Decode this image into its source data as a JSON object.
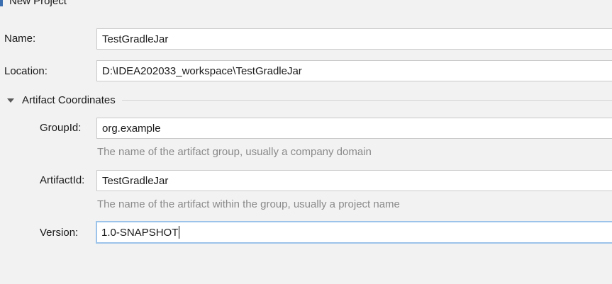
{
  "dialog": {
    "title": "New Project"
  },
  "name": {
    "label": "Name:",
    "value": "TestGradleJar"
  },
  "location": {
    "label": "Location:",
    "value": "D:\\IDEA202033_workspace\\TestGradleJar"
  },
  "artifact_section": {
    "title": "Artifact Coordinates",
    "expanded": true
  },
  "group_id": {
    "label": "GroupId:",
    "value": "org.example",
    "hint": "The name of the artifact group, usually a company domain"
  },
  "artifact_id": {
    "label": "ArtifactId:",
    "value": "TestGradleJar",
    "hint": "The name of the artifact within the group, usually a project name"
  },
  "version": {
    "label": "Version:",
    "value": "1.0-SNAPSHOT",
    "focused": true
  },
  "colors": {
    "accent": "#3b6fb0",
    "focus_border": "#9cc3ea",
    "hint_text": "#8a8a8a"
  },
  "icons": {
    "section_toggle": "expand-triangle-icon"
  }
}
